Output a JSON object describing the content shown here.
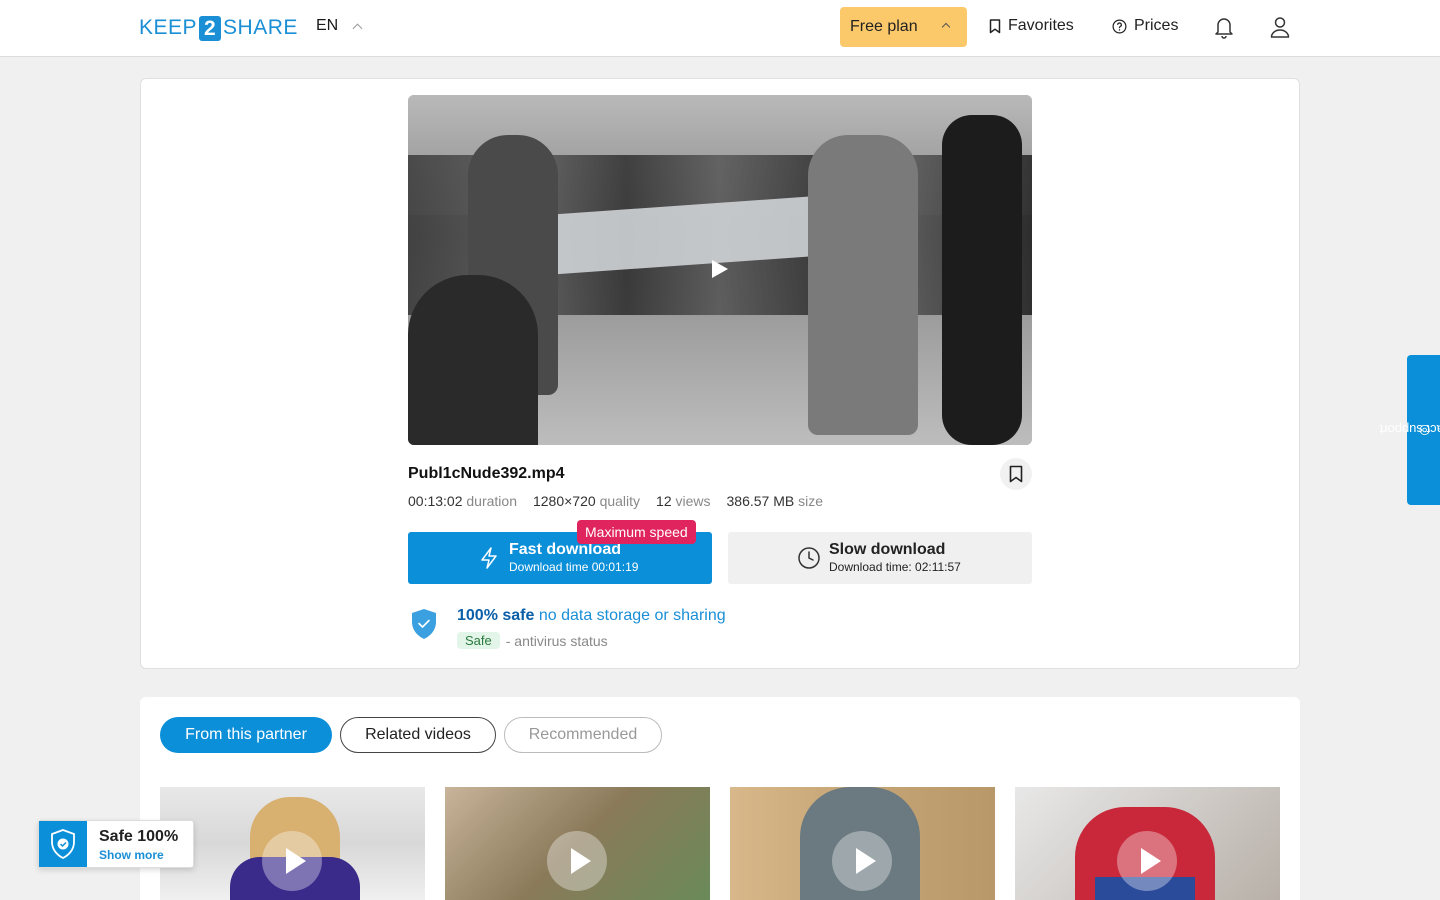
{
  "header": {
    "logo_left": "KEEP",
    "logo_mid": "2",
    "logo_right": "SHARE",
    "language": "EN",
    "plan_label": "Free plan",
    "favorites_label": "Favorites",
    "prices_label": "Prices"
  },
  "file": {
    "name": "Publ1cNude392.mp4",
    "duration": "00:13:02",
    "duration_label": "duration",
    "quality": "1280×720",
    "quality_label": "quality",
    "views": "12",
    "views_label": "views",
    "size": "386.57 MB",
    "size_label": "size"
  },
  "download": {
    "fast_label": "Fast download",
    "fast_time": "Download time 00:01:19",
    "badge": "Maximum speed",
    "slow_label": "Slow download",
    "slow_time": "Download time: 02:11:57"
  },
  "safety": {
    "headline": "100% safe",
    "tagline": "no data storage or sharing",
    "status_pill": "Safe",
    "status_text": "- antivirus status"
  },
  "tabs": [
    {
      "label": "From this partner"
    },
    {
      "label": "Related videos"
    },
    {
      "label": "Recommended"
    }
  ],
  "support_label": "contact support",
  "safe_widget": {
    "title": "Safe 100%",
    "link": "Show more"
  },
  "colors": {
    "primary": "#0a8fd8",
    "plan": "#fbc86a",
    "badge": "#e0245e"
  }
}
